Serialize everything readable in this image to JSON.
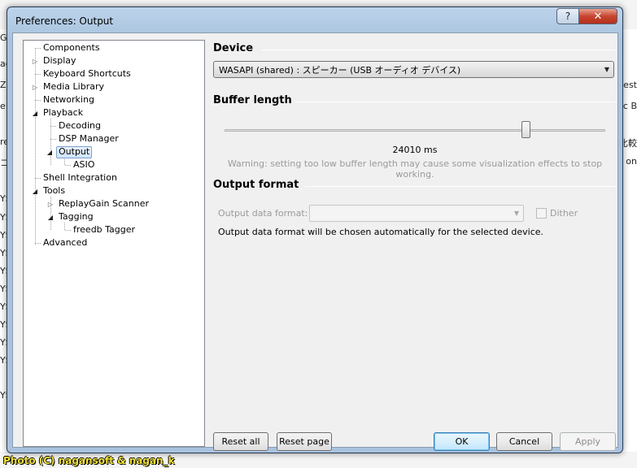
{
  "window": {
    "title": "Preferences: Output",
    "help_glyph": "?",
    "close_glyph": "✕"
  },
  "tree": {
    "items": [
      {
        "label": "Components",
        "expander": ""
      },
      {
        "label": "Display",
        "expander": "▷"
      },
      {
        "label": "Keyboard Shortcuts",
        "expander": ""
      },
      {
        "label": "Media Library",
        "expander": "▷"
      },
      {
        "label": "Networking",
        "expander": ""
      },
      {
        "label": "Playback",
        "expander": "◢"
      },
      {
        "label": "Decoding",
        "expander": ""
      },
      {
        "label": "DSP Manager",
        "expander": ""
      },
      {
        "label": "Output",
        "expander": "◢",
        "selected": true
      },
      {
        "label": "ASIO",
        "expander": ""
      },
      {
        "label": "Shell Integration",
        "expander": ""
      },
      {
        "label": "Tools",
        "expander": "◢"
      },
      {
        "label": "ReplayGain Scanner",
        "expander": "▷"
      },
      {
        "label": "Tagging",
        "expander": "◢"
      },
      {
        "label": "freedb Tagger",
        "expander": ""
      },
      {
        "label": "Advanced",
        "expander": ""
      }
    ]
  },
  "device": {
    "heading": "Device",
    "selected": "WASAPI (shared) : スピーカー (USB オーディオ デバイス)"
  },
  "buffer": {
    "heading": "Buffer length",
    "value_text": "24010 ms",
    "slider_fraction": 0.79,
    "warning": "Warning: setting too low buffer length may cause some visualization effects to stop working."
  },
  "output_format": {
    "heading": "Output format",
    "label": "Output data format:",
    "value": "",
    "dither_label": "Dither",
    "dither_checked": false,
    "note": "Output data format will be chosen automatically for the selected device."
  },
  "buttons": {
    "reset_all": "Reset all",
    "reset_page": "Reset page",
    "ok": "OK",
    "cancel": "Cancel",
    "apply": "Apply"
  },
  "watermark": "Photo (C) nagansoft & nagan_k",
  "background_app": {
    "left_fragments": [
      "GE",
      "ach",
      "ZI",
      "e L",
      "re",
      "コ",
      "YS",
      "YS",
      "YS",
      "YS",
      "YS",
      "YS",
      "YS",
      "YS",
      "YS",
      "YS",
      "YS"
    ],
    "right_fragments": [
      "Dest",
      "ic B",
      "比較",
      "on"
    ]
  }
}
